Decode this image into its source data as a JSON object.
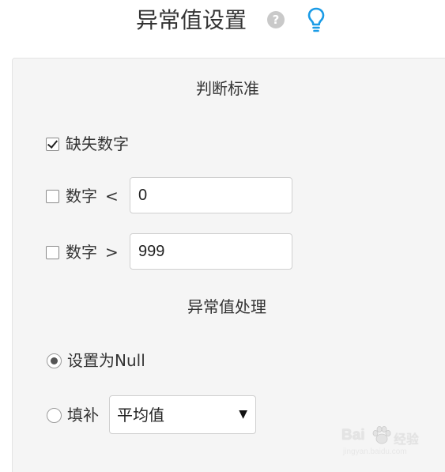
{
  "header": {
    "title": "异常值设置",
    "help_icon": "question-circle-icon",
    "help_glyph": "?",
    "tip_icon": "lightbulb-icon",
    "tip_color": "#1a9be6"
  },
  "criteria": {
    "title": "判断标准",
    "missing_number": {
      "label": "缺失数字",
      "checked": true
    },
    "less_than": {
      "label": "数字",
      "operator": "<",
      "value": "0",
      "checked": false
    },
    "greater_than": {
      "label": "数字",
      "operator": ">",
      "value": "999",
      "checked": false
    }
  },
  "handling": {
    "title": "异常值处理",
    "set_null": {
      "label": "设置为Null",
      "selected": true
    },
    "fill": {
      "label": "填补",
      "selected": false,
      "dropdown_value": "平均值",
      "dropdown_arrow": "▼"
    }
  },
  "watermark": {
    "brand": "Bai",
    "brand_suffix": "经验",
    "url": "jingyan.baidu.com"
  },
  "colors": {
    "panel_bg": "#f5f5f5",
    "accent": "#1a9be6"
  }
}
